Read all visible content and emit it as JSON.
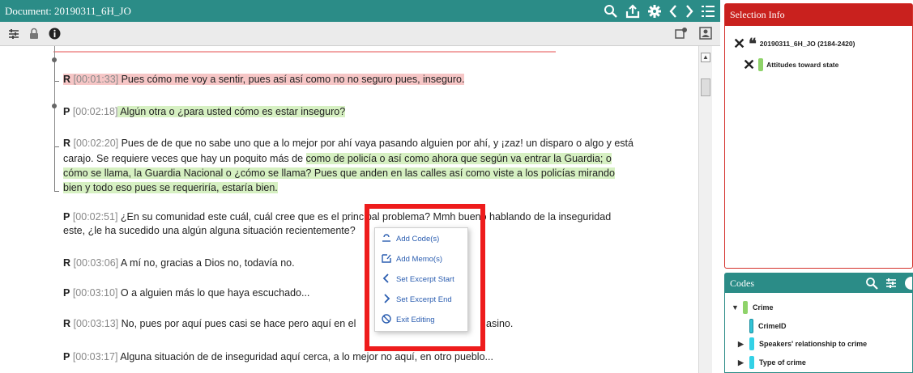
{
  "document": {
    "title": "Document: 20190311_6H_JO",
    "lines": [
      {
        "speaker": "R",
        "time": "[00:01:33]",
        "text": "  Pues cómo me voy a sentir, pues así así como no no seguro pues, inseguro."
      },
      {
        "speaker": "P",
        "time": "[00:02:18]",
        "text": " Algún otra o ¿para usted cómo es estar inseguro?"
      },
      {
        "speaker": "R",
        "time": "[00:02:20]",
        "text": " Pues de de que no sabe uno que a lo mejor por ahí vaya pasando alguien por ahí, y ¡zaz! un disparo o algo y está"
      },
      {
        "pre": "carajo. Se requiere veces que hay un poquito más de ",
        "hl": "como de policía o así como ahora que según va entrar la Guardia; o"
      },
      {
        "hl": "cómo se llama, la Guardia Nacional o ¿cómo se llama? Pues que anden en las calles así como viste a los policías mirando"
      },
      {
        "hl": "bien y todo eso pues se requeriría, estaría bien."
      },
      {
        "speaker": "P",
        "time": "[00:02:51]",
        "text": "  ¿En su comunidad este cuál, cuál cree que es el principal problema? Mmh bueno hablando de la inseguridad"
      },
      {
        "text": "este, ¿le ha sucedido una algún alguna situación recientemente?"
      },
      {
        "speaker": "R",
        "time": "[00:03:06]",
        "text": " A mí no, gracias a Dios no, todavía no."
      },
      {
        "speaker": "P",
        "time": "[00:03:10]",
        "text": "  O a alguien más lo que haya escuchado..."
      },
      {
        "speaker": "R",
        "time": "[00:03:13]",
        "text": " No, pues por aquí pues casi se hace pero aquí en el ",
        "tail": "asino."
      },
      {
        "speaker": "P",
        "time": "[00:03:17]",
        "text": " Alguna situación de de inseguridad aquí cerca, a lo mejor no aquí, en otro pueblo..."
      }
    ]
  },
  "context_menu": {
    "items": [
      {
        "label": "Add Code(s)",
        "icon": "code-tag-icon"
      },
      {
        "label": "Add Memo(s)",
        "icon": "memo-icon"
      },
      {
        "label": "Set Excerpt Start",
        "icon": "chevron-left-icon"
      },
      {
        "label": "Set Excerpt End",
        "icon": "chevron-right-icon"
      },
      {
        "label": "Exit Editing",
        "icon": "exit-icon"
      }
    ]
  },
  "selection_info": {
    "title": "Selection Info",
    "excerpt": "20190311_6H_JO (2184-2420)",
    "code": "Attitudes toward state"
  },
  "codes": {
    "title": "Codes",
    "items": [
      {
        "label": "Crime",
        "color": "#8fd36a"
      },
      {
        "label": "CrimeID",
        "color": "#33c3d6"
      },
      {
        "label": "Speakers' relationship to crime",
        "color": "#33d1e6"
      },
      {
        "label": "Type of crime",
        "color": "#33d1e6"
      }
    ]
  },
  "colors": {
    "teal": "#2b8c87",
    "red": "#c9211e",
    "highlight_red": "#f6c6c6",
    "highlight_green": "#d6f0c2",
    "menu_text": "#2a5db0"
  }
}
